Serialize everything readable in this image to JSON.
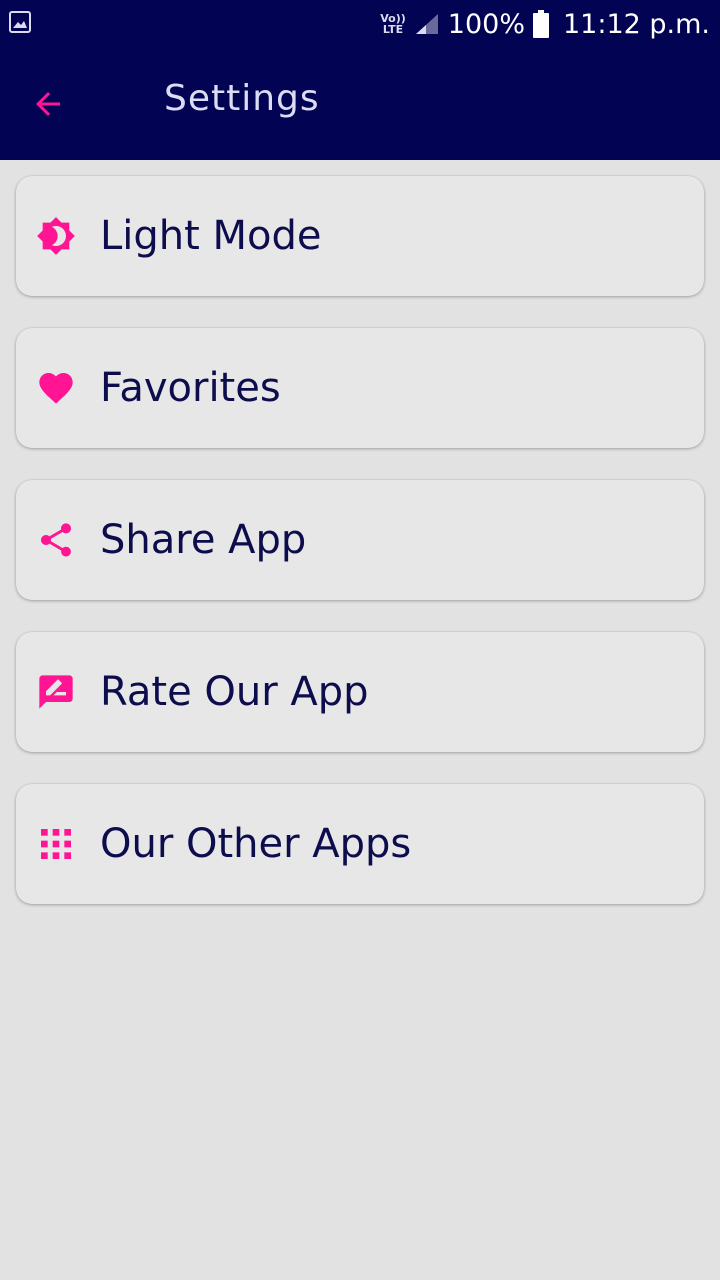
{
  "status_bar": {
    "volte_top": "Vo))",
    "volte_bottom": "LTE",
    "battery": "100%",
    "time": "11:12 p.m."
  },
  "app_bar": {
    "title": "Settings"
  },
  "colors": {
    "app_bar_bg": "#030354",
    "accent": "#ff1493",
    "card_bg": "#e7e7e7",
    "text_primary": "#0d0d4d"
  },
  "settings": {
    "items": [
      {
        "label": "Light Mode",
        "icon": "brightness-icon"
      },
      {
        "label": "Favorites",
        "icon": "heart-icon"
      },
      {
        "label": "Share App",
        "icon": "share-icon"
      },
      {
        "label": "Rate Our App",
        "icon": "rate-review-icon"
      },
      {
        "label": "Our Other Apps",
        "icon": "apps-grid-icon"
      }
    ]
  }
}
